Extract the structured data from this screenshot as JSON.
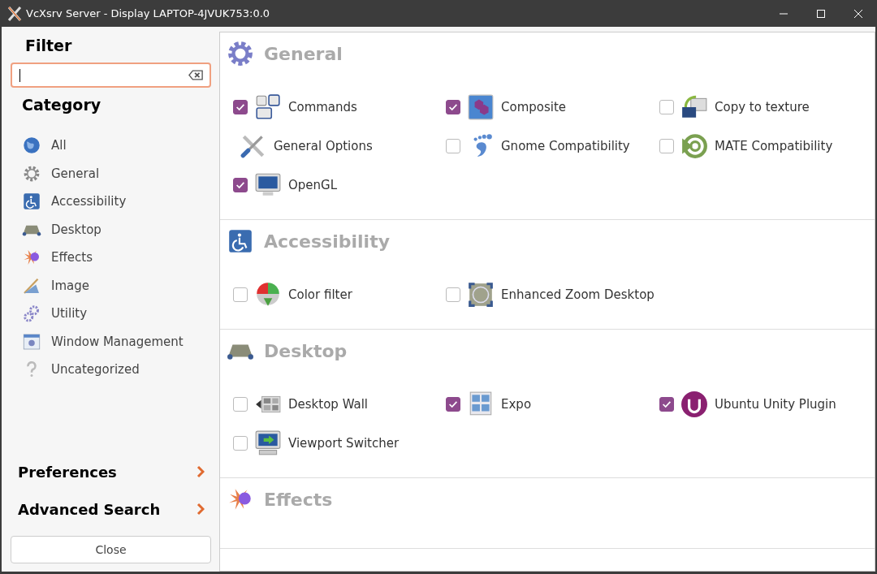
{
  "window": {
    "title": "VcXsrv Server - Display LAPTOP-4JVUK753:0.0"
  },
  "sidebar": {
    "filter_heading": "Filter",
    "filter_field": {
      "focused": true
    },
    "category_heading": "Category",
    "categories": [
      {
        "label": "All",
        "selected": false
      },
      {
        "label": "General",
        "selected": false
      },
      {
        "label": "Accessibility",
        "selected": false
      },
      {
        "label": "Desktop",
        "selected": false
      },
      {
        "label": "Effects",
        "selected": false
      },
      {
        "label": "Image",
        "selected": false
      },
      {
        "label": "Utility",
        "selected": false
      },
      {
        "label": "Window Management",
        "selected": false
      },
      {
        "label": "Uncategorized",
        "selected": false
      }
    ],
    "links": [
      {
        "label": "Preferences"
      },
      {
        "label": "Advanced Search"
      }
    ],
    "close_button": "Close"
  },
  "sections": [
    {
      "title": "General",
      "plugins": [
        {
          "label": "Commands",
          "kind": "plugin",
          "checked": true
        },
        {
          "label": "Composite",
          "kind": "plugin",
          "checked": true
        },
        {
          "label": "Copy to texture",
          "kind": "plugin",
          "checked": false
        },
        {
          "label": "General Options",
          "kind": "core"
        },
        {
          "label": "Gnome Compatibility",
          "kind": "plugin",
          "checked": false
        },
        {
          "label": "MATE Compatibility",
          "kind": "plugin",
          "checked": false
        },
        {
          "label": "OpenGL",
          "kind": "plugin",
          "checked": true
        }
      ]
    },
    {
      "title": "Accessibility",
      "plugins": [
        {
          "label": "Color filter",
          "kind": "plugin",
          "checked": false
        },
        {
          "label": "Enhanced Zoom Desktop",
          "kind": "plugin",
          "checked": false
        }
      ]
    },
    {
      "title": "Desktop",
      "plugins": [
        {
          "label": "Desktop Wall",
          "kind": "plugin",
          "checked": false
        },
        {
          "label": "Expo",
          "kind": "plugin",
          "checked": true
        },
        {
          "label": "Ubuntu Unity Plugin",
          "kind": "plugin",
          "checked": true
        },
        {
          "label": "Viewport Switcher",
          "kind": "plugin",
          "checked": false
        }
      ]
    },
    {
      "title": "Effects"
    }
  ]
}
